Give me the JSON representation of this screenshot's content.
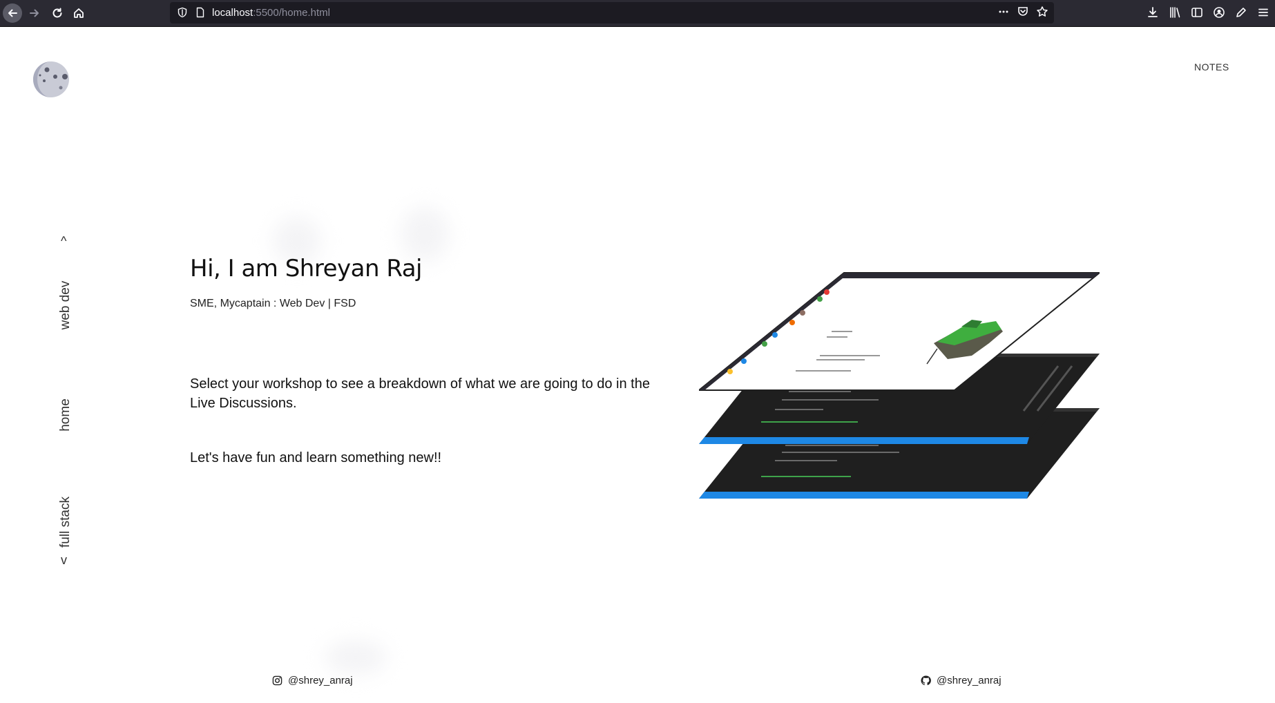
{
  "browser": {
    "url_host": "localhost",
    "url_rest": ":5500/home.html"
  },
  "header": {
    "notes_label": "NOTES"
  },
  "side_nav": {
    "up_arrow": "^",
    "items": [
      {
        "label": "web dev"
      },
      {
        "label": "home"
      },
      {
        "label": "full stack"
      }
    ],
    "down_arrow": "v"
  },
  "hero": {
    "title": "Hi, I am Shreyan Raj",
    "subtitle": "SME, Mycaptain : Web Dev | FSD",
    "description": "Select your workshop to see a breakdown of what we are going to do in the Live Discussions.",
    "fun": "Let's have fun and learn something new!!"
  },
  "footer": {
    "instagram_handle": "@shrey_anraj",
    "github_handle": "@shrey_anraj"
  },
  "icons": {
    "back": "back-arrow-icon",
    "forward": "forward-arrow-icon",
    "reload": "reload-icon",
    "home": "home-icon",
    "shield": "tracking-shield-icon",
    "page": "page-info-icon",
    "more": "more-dots-icon",
    "pocket": "pocket-icon",
    "star": "bookmark-star-icon",
    "download": "download-icon",
    "library": "library-icon",
    "sidebar": "sidebar-icon",
    "account": "account-icon",
    "pen": "pen-icon",
    "menu": "hamburger-menu-icon",
    "logo": "moon-logo-icon",
    "instagram": "instagram-icon",
    "github": "github-icon"
  },
  "colors": {
    "chrome_bg": "#2b2a33",
    "urlbar_bg": "#1c1b22",
    "accent_blue": "#1e88e5"
  }
}
